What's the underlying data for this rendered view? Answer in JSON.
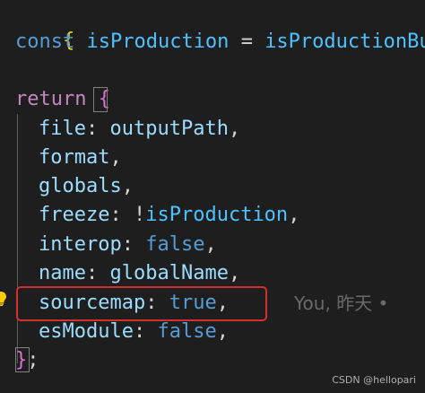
{
  "code": {
    "line1": {
      "brace": "{"
    },
    "line2": {
      "keyword": "const",
      "name": "isProduction",
      "op": "=",
      "value": "isProductionBun"
    },
    "line4": {
      "keyword": "return",
      "brace": "{"
    },
    "props": [
      {
        "key": "file",
        "colon": ":",
        "value": "outputPath",
        "comma": ","
      },
      {
        "key": "format",
        "comma": ","
      },
      {
        "key": "globals",
        "comma": ","
      },
      {
        "key": "freeze",
        "colon": ":",
        "not": "!",
        "value": "isProduction",
        "comma": ","
      },
      {
        "key": "interop",
        "colon": ":",
        "value": "false",
        "comma": ","
      },
      {
        "key": "name",
        "colon": ":",
        "value": "globalName",
        "comma": ","
      },
      {
        "key": "sourcemap",
        "colon": ":",
        "value": "true",
        "comma": ","
      },
      {
        "key": "esModule",
        "colon": ":",
        "value": "false",
        "comma": ","
      }
    ],
    "closing": {
      "brace": "}",
      "semi": ";"
    }
  },
  "blame": "You, 昨天 •",
  "watermark": "CSDN @hellopari",
  "colors": {
    "background": "#1e1e1e",
    "highlight_border": "#d32f2f",
    "keyword": "#569cd6",
    "control_keyword": "#c586c0",
    "property": "#9cdcfe",
    "constant": "#4fc1ff",
    "brace_outer": "#ffd700",
    "brace_inner": "#da70d6"
  },
  "icons": {
    "lightbulb": "lightbulb-icon"
  }
}
